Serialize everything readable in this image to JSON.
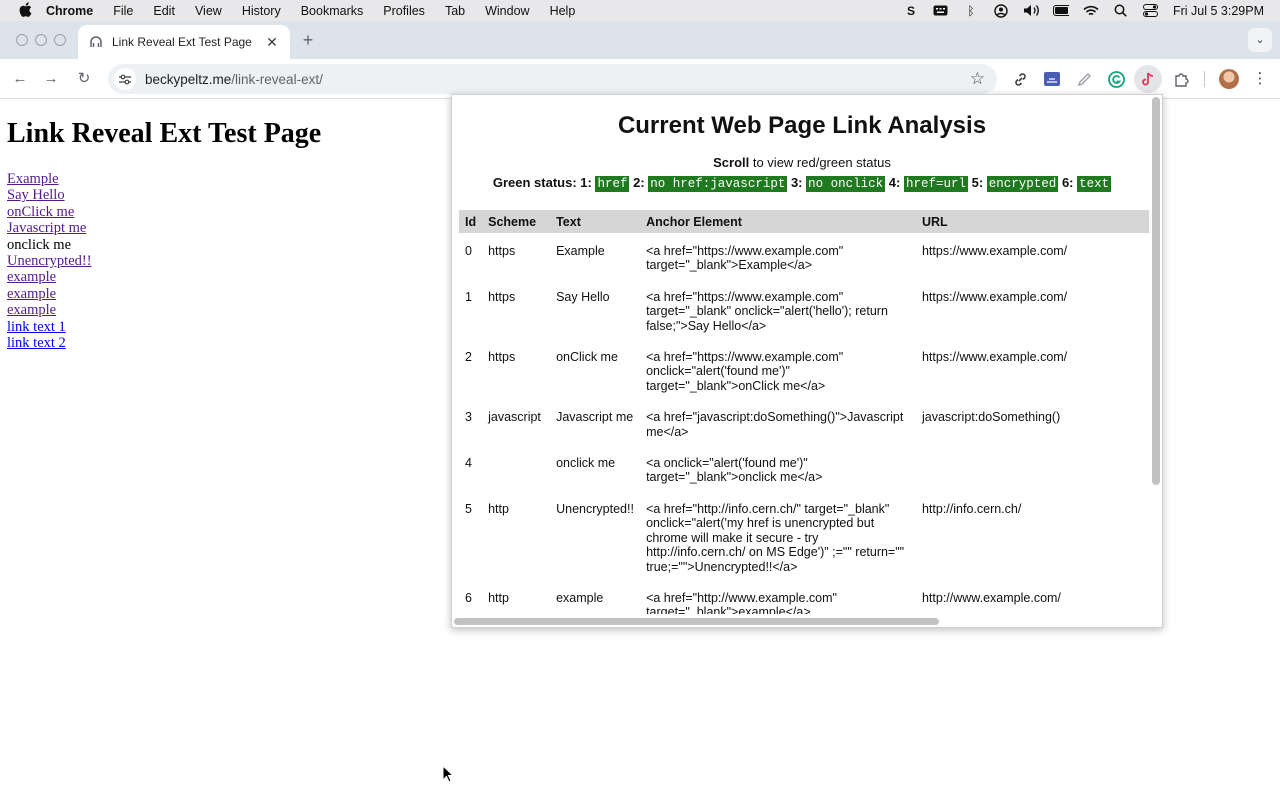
{
  "menubar": {
    "app": "Chrome",
    "items": [
      "File",
      "Edit",
      "View",
      "History",
      "Bookmarks",
      "Profiles",
      "Tab",
      "Window",
      "Help"
    ],
    "clock": "Fri Jul 5  3:29PM"
  },
  "browser": {
    "tab_title": "Link Reveal Ext Test Page",
    "url_host": "beckypeltz.me",
    "url_path": "/link-reveal-ext/"
  },
  "page": {
    "heading": "Link Reveal Ext Test Page",
    "links": [
      {
        "text": "Example",
        "kind": "visited"
      },
      {
        "text": "Say Hello",
        "kind": "visited"
      },
      {
        "text": "onClick me",
        "kind": "visited"
      },
      {
        "text": "Javascript me",
        "kind": "visited"
      },
      {
        "text": "onclick me",
        "kind": "plain"
      },
      {
        "text": "Unencrypted!!",
        "kind": "visited"
      },
      {
        "text": "example",
        "kind": "visited"
      },
      {
        "text": "example",
        "kind": "visited"
      },
      {
        "text": "example",
        "kind": "visited"
      },
      {
        "text": "link text 1",
        "kind": "link"
      },
      {
        "text": "link text 2",
        "kind": "link"
      }
    ]
  },
  "popup": {
    "title": "Current Web Page Link Analysis",
    "scroll_bold": "Scroll",
    "scroll_rest": " to view red/green status",
    "status_label": "Green status:",
    "badges": [
      {
        "num": "1:",
        "label": "href"
      },
      {
        "num": "2:",
        "label": "no href:javascript"
      },
      {
        "num": "3:",
        "label": "no onclick"
      },
      {
        "num": "4:",
        "label": "href=url"
      },
      {
        "num": "5:",
        "label": "encrypted"
      },
      {
        "num": "6:",
        "label": "text"
      }
    ],
    "badge_color": "#1f7a1f",
    "columns": [
      "Id",
      "Scheme",
      "Text",
      "Anchor Element",
      "URL"
    ],
    "rows": [
      {
        "id": "0",
        "scheme": "https",
        "text": "Example",
        "anchor": "<a href=\"https://www.example.com\" target=\"_blank\">Example</a>",
        "url": "https://www.example.com/"
      },
      {
        "id": "1",
        "scheme": "https",
        "text": "Say Hello",
        "anchor": "<a href=\"https://www.example.com\" target=\"_blank\" onclick=\"alert('hello'); return false;\">Say Hello</a>",
        "url": "https://www.example.com/"
      },
      {
        "id": "2",
        "scheme": "https",
        "text": "onClick me",
        "anchor": "<a href=\"https://www.example.com\" onclick=\"alert('found me')\" target=\"_blank\">onClick me</a>",
        "url": "https://www.example.com/"
      },
      {
        "id": "3",
        "scheme": "javascript",
        "text": "Javascript me",
        "anchor": "<a href=\"javascript:doSomething()\">Javascript me</a>",
        "url": "javascript:doSomething()"
      },
      {
        "id": "4",
        "scheme": "",
        "text": "onclick me",
        "anchor": "<a onclick=\"alert('found me')\" target=\"_blank\">onclick me</a>",
        "url": ""
      },
      {
        "id": "5",
        "scheme": "http",
        "text": "Unencrypted!!",
        "anchor": "<a href=\"http://info.cern.ch/\" target=\"_blank\" onclick=\"alert('my href is unencrypted but chrome will make it secure - try http://info.cern.ch/ on MS Edge')\" ;=\"\" return=\"\" true;=\"\">Unencrypted!!</a>",
        "url": "http://info.cern.ch/"
      },
      {
        "id": "6",
        "scheme": "http",
        "text": "example",
        "anchor": "<a href=\"http://www.example.com\" target=\"_blank\">example</a>",
        "url": "http://www.example.com/"
      }
    ]
  }
}
